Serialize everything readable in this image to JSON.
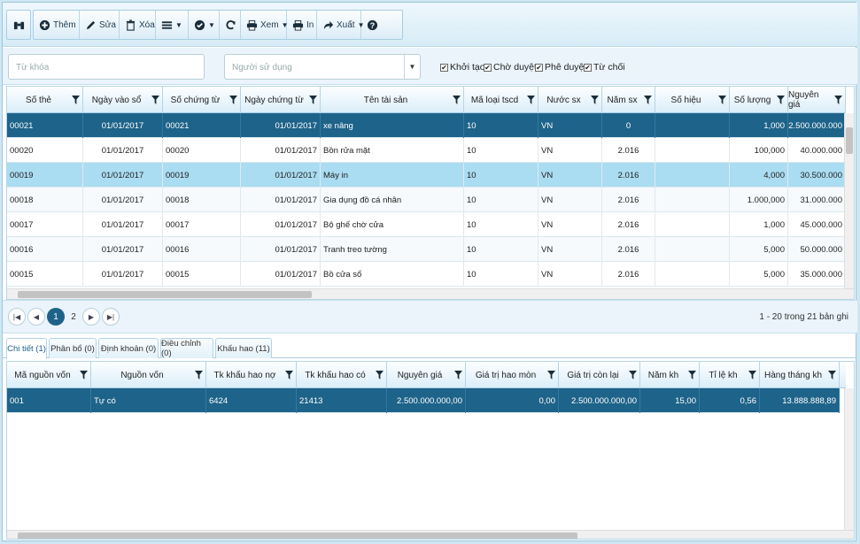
{
  "toolbar": {
    "add": "Thêm",
    "edit": "Sửa",
    "delete": "Xóa",
    "view": "Xem",
    "print": "In",
    "export": "Xuất"
  },
  "filters": {
    "keyword_placeholder": "Từ khóa",
    "user_placeholder": "Người sử dụng",
    "checks": [
      "Khởi tạo",
      "Chờ duyệt",
      "Phê duyệt",
      "Từ chối"
    ]
  },
  "main_grid": {
    "columns": [
      "Số thẻ",
      "Ngày vào sổ",
      "Số chứng từ",
      "Ngày chứng từ",
      "Tên tài sản",
      "Mã loại tscd",
      "Nước sx",
      "Năm sx",
      "Số hiệu",
      "Số lượng",
      "Nguyên giá"
    ],
    "rows": [
      [
        "00021",
        "01/01/2017",
        "00021",
        "01/01/2017",
        "xe nâng",
        "10",
        "VN",
        "0",
        "",
        "1,000",
        "2.500.000.000"
      ],
      [
        "00020",
        "01/01/2017",
        "00020",
        "01/01/2017",
        "Bồn rửa mặt",
        "10",
        "VN",
        "2.016",
        "",
        "100,000",
        "40.000.000"
      ],
      [
        "00019",
        "01/01/2017",
        "00019",
        "01/01/2017",
        "Máy in",
        "10",
        "VN",
        "2.016",
        "",
        "4,000",
        "30.500.000"
      ],
      [
        "00018",
        "01/01/2017",
        "00018",
        "01/01/2017",
        "Gia dụng đồ cá nhân",
        "10",
        "VN",
        "2.016",
        "",
        "1.000,000",
        "31.000.000"
      ],
      [
        "00017",
        "01/01/2017",
        "00017",
        "01/01/2017",
        "Bộ ghế chờ cửa",
        "10",
        "VN",
        "2.016",
        "",
        "1,000",
        "45.000.000"
      ],
      [
        "00016",
        "01/01/2017",
        "00016",
        "01/01/2017",
        "Tranh treo tường",
        "10",
        "VN",
        "2.016",
        "",
        "5,000",
        "50.000.000"
      ],
      [
        "00015",
        "01/01/2017",
        "00015",
        "01/01/2017",
        "Bồ cửa sổ",
        "10",
        "VN",
        "2.016",
        "",
        "5,000",
        "35.000.000"
      ]
    ]
  },
  "pager": {
    "pages": [
      "1",
      "2"
    ],
    "info": "1 - 20 trong 21 bản ghi"
  },
  "tabs": [
    "Chi tiết (1)",
    "Phân bổ (0)",
    "Định khoản (0)",
    "Điều chỉnh (0)",
    "Khấu hao (11)"
  ],
  "detail_grid": {
    "columns": [
      "Mã nguồn vốn",
      "Nguồn vốn",
      "Tk khấu hao nợ",
      "Tk khấu hao có",
      "Nguyên giá",
      "Giá trị hao mòn",
      "Giá trị còn lại",
      "Năm kh",
      "Tỉ lệ kh",
      "Hàng tháng kh"
    ],
    "rows": [
      [
        "001",
        "Tự có",
        "6424",
        "21413",
        "2.500.000.000,00",
        "0,00",
        "2.500.000.000,00",
        "15,00",
        "0,56",
        "13.888.888,89"
      ]
    ]
  },
  "colors": {
    "selected_row": "#1e6389",
    "highlight_row": "#aadcf2",
    "accent": "#1e6389"
  }
}
